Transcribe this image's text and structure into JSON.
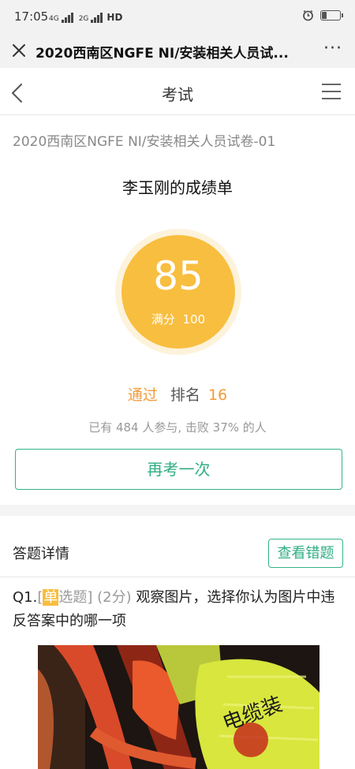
{
  "status_bar": {
    "time": "17:05",
    "signal_1": "4G",
    "signal_2": "2G",
    "hd_label": "HD",
    "battery_level": 0.3
  },
  "webview": {
    "title": "2020西南区NGFE NI/安装相关人员试..."
  },
  "header": {
    "title": "考试"
  },
  "exam": {
    "name": "2020西南区NGFE NI/安装相关人员试卷-01",
    "report_title": "李玉刚的成绩单",
    "score": "85",
    "full_label": "满分",
    "full_score": "100",
    "result": "通过",
    "rank_label": "排名",
    "rank": "16",
    "stats_text": "已有 484 人参与, 击败 37% 的人",
    "retry_label": "再考一次"
  },
  "details": {
    "title": "答题详情",
    "wrong_button_label": "查看错题"
  },
  "question": {
    "number": "Q1.",
    "type_open": "[",
    "type_badge": "单",
    "type_rest": "选题]",
    "points": "(2分)",
    "text": "观察图片，选择你认为图片中违反答案中的哪一项",
    "image_text": "电缆装"
  },
  "colors": {
    "accent_green": "#2fae84",
    "score_orange": "#f8be3f",
    "pass_orange": "#f29a3a"
  }
}
